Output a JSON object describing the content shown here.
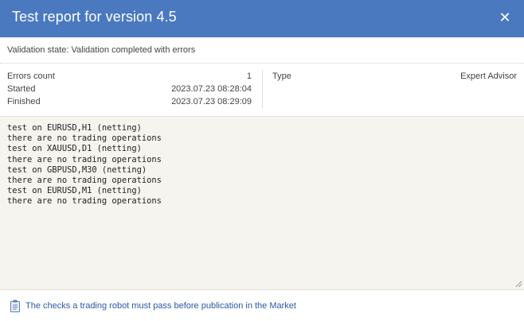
{
  "dialog": {
    "title": "Test report for version 4.5",
    "close_glyph": "✕"
  },
  "validation": {
    "text": "Validation state: Validation completed with errors"
  },
  "info": {
    "left": [
      {
        "label": "Errors count",
        "value": "1"
      },
      {
        "label": "Started",
        "value": "2023.07.23 08:28:04"
      },
      {
        "label": "Finished",
        "value": "2023.07.23 08:29:09"
      }
    ],
    "right": [
      {
        "label": "Type",
        "value": "Expert Advisor"
      }
    ]
  },
  "log": {
    "lines": [
      "test on EURUSD,H1 (netting)",
      "there are no trading operations",
      "test on XAUUSD,D1 (netting)",
      "there are no trading operations",
      "test on GBPUSD,M30 (netting)",
      "there are no trading operations",
      "test on EURUSD,M1 (netting)",
      "there are no trading operations"
    ]
  },
  "footer": {
    "link_text": "The checks a trading robot must pass before publication in the Market",
    "icon": "clipboard-icon"
  },
  "colors": {
    "header_bg": "#4a79c0",
    "log_bg": "#f5f4ee",
    "link": "#2b59a5"
  }
}
